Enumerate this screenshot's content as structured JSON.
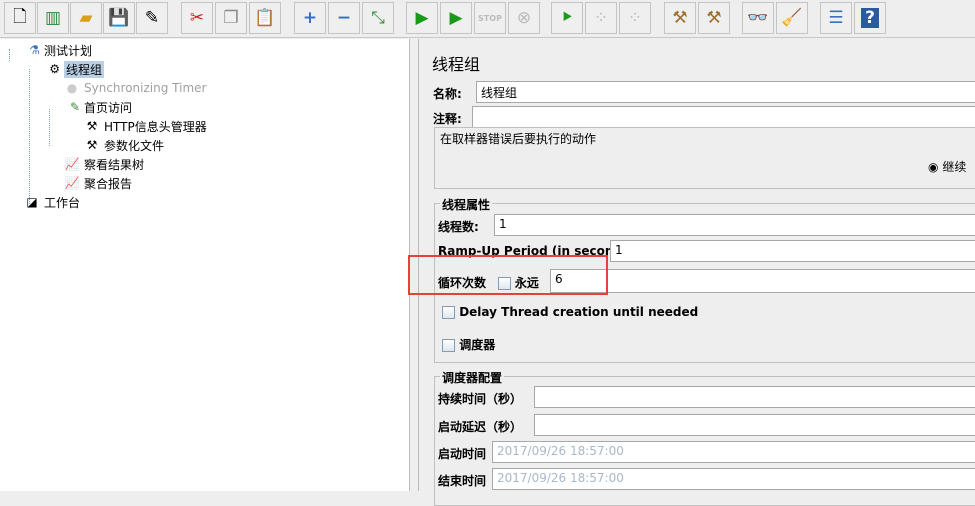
{
  "toolbar": {
    "buttons": [
      "new",
      "templates",
      "open",
      "save",
      "save-as",
      "cut",
      "copy",
      "paste",
      "expand",
      "collapse",
      "toggle",
      "start",
      "start-no-pauses",
      "stop",
      "shutdown",
      "remote-start",
      "remote-stop",
      "remote-stop-all",
      "clear",
      "clear-all",
      "search",
      "reset-search",
      "function-helper",
      "help"
    ],
    "stop_label": "STOP"
  },
  "tree": {
    "items": [
      {
        "label": "测试计划",
        "icon": "test-plan-icon"
      },
      {
        "label": "线程组",
        "icon": "gear-icon"
      },
      {
        "label": "Synchronizing Timer",
        "icon": "timer-icon"
      },
      {
        "label": "首页访问",
        "icon": "sampler-icon"
      },
      {
        "label": "HTTP信息头管理器",
        "icon": "tools-icon"
      },
      {
        "label": "参数化文件",
        "icon": "tools-icon"
      },
      {
        "label": "察看结果树",
        "icon": "chart-icon"
      },
      {
        "label": "聚合报告",
        "icon": "chart-icon"
      },
      {
        "label": "工作台",
        "icon": "workbench-icon"
      }
    ]
  },
  "panel": {
    "title": "线程组",
    "name_label": "名称:",
    "name_value": "线程组",
    "comment_label": "注释:",
    "comment_value": "",
    "error_action_title": "在取样器错误后要执行的动作",
    "error_action_selected": "继续",
    "thread_props_title": "线程属性",
    "threads_label": "线程数:",
    "threads_value": "1",
    "rampup_label": "Ramp-Up Period (in seconds):",
    "rampup_value": "1",
    "loop_label": "循环次数",
    "forever_label": "永远",
    "loop_value": "6",
    "delay_label": "Delay Thread creation until needed",
    "scheduler_label": "调度器",
    "scheduler_config_title": "调度器配置",
    "duration_label": "持续时间（秒）",
    "duration_value": "",
    "startup_delay_label": "启动延迟（秒）",
    "startup_delay_value": "",
    "start_time_label": "启动时间",
    "start_time_value": "2017/09/26 18:57:00",
    "end_time_label": "结束时间",
    "end_time_value": "2017/09/26 18:57:00"
  },
  "colors": {
    "highlight": "#e8403a",
    "selection": "#b8cfe5"
  }
}
